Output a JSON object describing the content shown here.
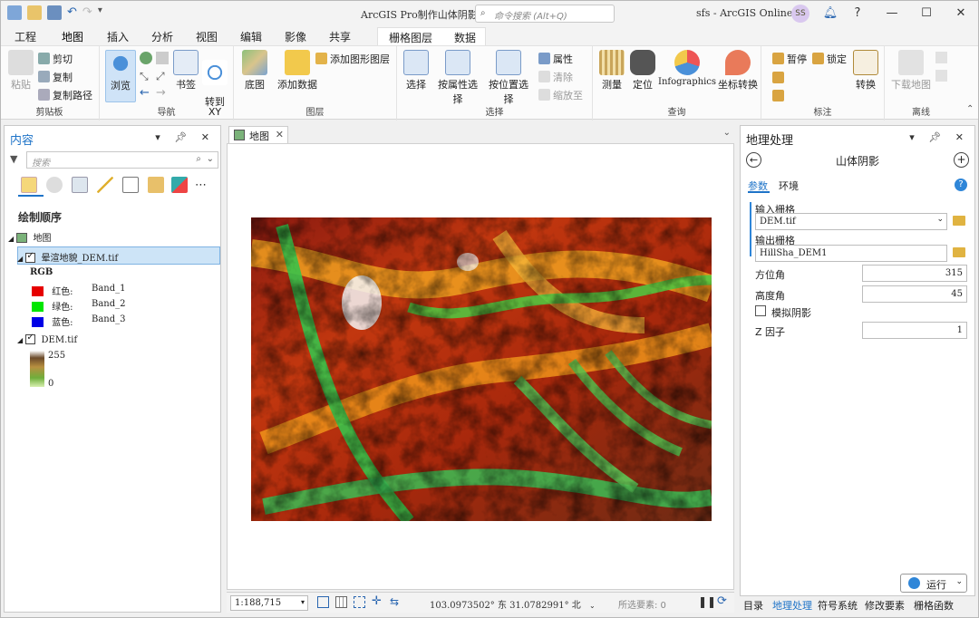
{
  "window": {
    "title": "ArcGIS Pro制作山体阴影",
    "command_search_placeholder": "命令搜索 (Alt+Q)",
    "user": "sfs - ArcGIS Online",
    "avatar_initials": "SS",
    "help": "?",
    "minimize": "—",
    "maximize": "☐",
    "close": "✕"
  },
  "ribbon_tabs": [
    "工程",
    "地图",
    "插入",
    "分析",
    "视图",
    "编辑",
    "影像",
    "共享"
  ],
  "context_tabs": [
    "栅格图层",
    "数据"
  ],
  "ribbon": {
    "clipboard": {
      "label": "剪贴板",
      "paste": "粘贴",
      "cut": "剪切",
      "copy": "复制",
      "copy_path": "复制路径"
    },
    "navigate": {
      "label": "导航",
      "explore": "浏览",
      "bookmarks": "书签",
      "goto_xy": "转到\nXY"
    },
    "layer": {
      "label": "图层",
      "basemap": "底图",
      "add_data": "添加数据",
      "add_graphics": "添加图形图层"
    },
    "selection": {
      "label": "选择",
      "select": "选择",
      "select_by_attr": "按属性选择",
      "select_by_loc": "按位置选择",
      "attributes": "属性",
      "clear": "清除",
      "zoom_to": "缩放至"
    },
    "inquiry": {
      "label": "查询",
      "measure": "测量",
      "locate": "定位",
      "infographics": "Infographics",
      "convert_coords": "坐标转换"
    },
    "labeling": {
      "label": "标注",
      "pause": "暂停",
      "lock": "锁定",
      "convert": "转换"
    },
    "offline": {
      "label": "离线",
      "download_map": "下载地图"
    }
  },
  "contents": {
    "title": "内容",
    "search_placeholder": "搜索",
    "drawing_order": "绘制顺序",
    "map_name": "地图",
    "layers": [
      {
        "name": "晕渲地貌_DEM.tif",
        "legend_title": "RGB",
        "bands": [
          {
            "label": "红色:",
            "band": "Band_1",
            "color": "#e60000"
          },
          {
            "label": "绿色:",
            "band": "Band_2",
            "color": "#00e600"
          },
          {
            "label": "蓝色:",
            "band": "Band_3",
            "color": "#0000e6"
          }
        ]
      },
      {
        "name": "DEM.tif",
        "max": "255",
        "min": "0"
      }
    ]
  },
  "map_tab": {
    "label": "地图"
  },
  "status": {
    "scale": "1:188,715",
    "coords": "103.0973502° 东 31.0782991° 北",
    "selected_features": "所选要素: 0"
  },
  "geoprocessing": {
    "title": "地理处理",
    "tool_name": "山体阴影",
    "tabs": [
      "参数",
      "环境"
    ],
    "input_raster_label": "输入栅格",
    "input_raster": "DEM.tif",
    "output_raster_label": "输出栅格",
    "output_raster": "HillSha_DEM1",
    "azimuth_label": "方位角",
    "azimuth": "315",
    "altitude_label": "高度角",
    "altitude": "45",
    "model_shadows_label": "模拟阴影",
    "z_factor_label": "Z 因子",
    "z_factor": "1",
    "run": "运行"
  },
  "bottom_tabs": [
    "目录",
    "地理处理",
    "符号系统",
    "修改要素",
    "栅格函数"
  ],
  "colors": {
    "accent": "#1e73c8"
  }
}
